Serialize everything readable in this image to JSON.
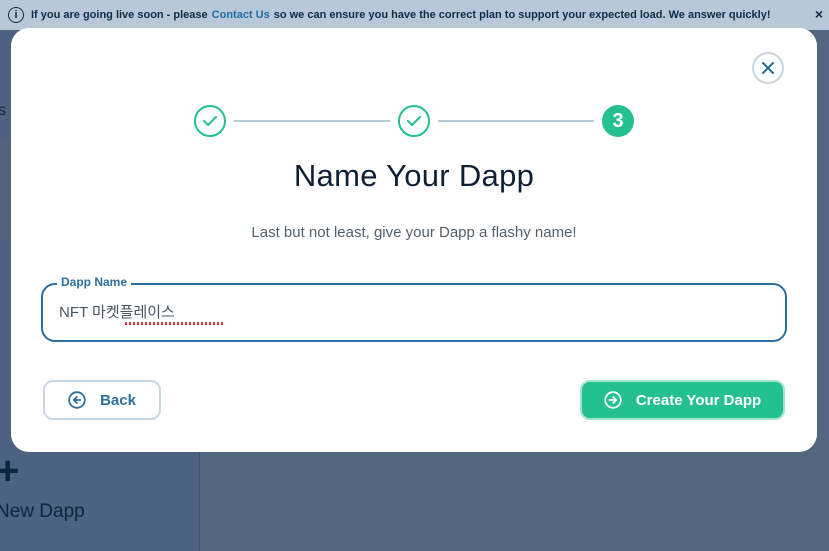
{
  "banner": {
    "info_icon": "i",
    "text_before": "If you are going live soon - please",
    "link": "Contact Us",
    "text_after": "so we can ensure you have the correct plan to support your expected load. We answer quickly!",
    "close": "×"
  },
  "sidebar": {
    "partial_letter": "s"
  },
  "new_dapp": {
    "icon": "+",
    "label": "New Dapp"
  },
  "modal": {
    "steps": [
      {
        "state": "done",
        "icon": "check-icon"
      },
      {
        "state": "done",
        "icon": "check-icon"
      },
      {
        "state": "current",
        "number": "3"
      }
    ],
    "title": "Name Your Dapp",
    "subtitle": "Last but not least, give your Dapp a flashy name!",
    "field": {
      "label": "Dapp Name",
      "value": "NFT 마켓플레이스"
    },
    "back_label": "Back",
    "create_label": "Create Your Dapp"
  },
  "colors": {
    "accent": "#24c08f",
    "primary": "#2d6f9d",
    "overlay": "#5a6c8a"
  }
}
